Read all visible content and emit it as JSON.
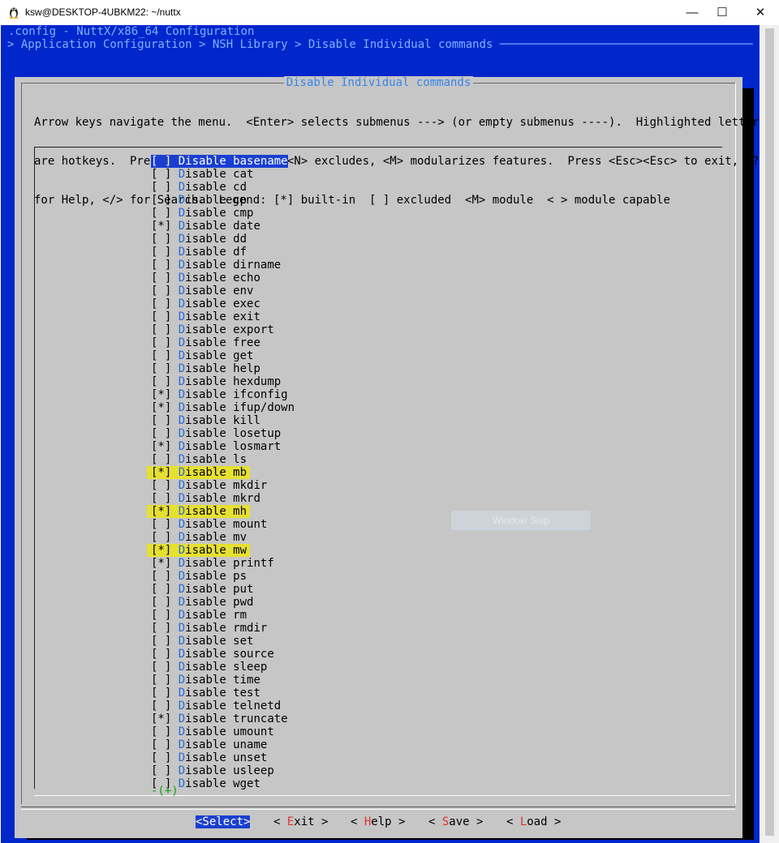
{
  "window": {
    "title": "ksw@DESKTOP-4UBKM22: ~/nuttx",
    "minimize": "—",
    "maximize": "☐",
    "close": "✕"
  },
  "header": {
    "line1": ".config - NuttX/x86_64 Configuration",
    "line2": "> Application Configuration > NSH Library > Disable Individual commands ─────────────────────────────────────"
  },
  "dialog": {
    "title": "Disable Individual commands",
    "help_lines": [
      "Arrow keys navigate the menu.  <Enter> selects submenus ---> (or empty submenus ----).  Highlighted letters",
      "are hotkeys.  Pressing <Y> includes, <N> excludes, <M> modularizes features.  Press <Esc><Esc> to exit, <?>",
      "for Help, </> for Search.  Legend: [*] built-in  [ ] excluded  <M> module  < > module capable"
    ]
  },
  "menu": {
    "items": [
      {
        "box": "[ ]",
        "hotkey": "D",
        "label": "isable basename",
        "selected": true
      },
      {
        "box": "[ ]",
        "hotkey": "D",
        "label": "isable cat"
      },
      {
        "box": "[ ]",
        "hotkey": "D",
        "label": "isable cd"
      },
      {
        "box": "[ ]",
        "hotkey": "D",
        "label": "isable cp"
      },
      {
        "box": "[ ]",
        "hotkey": "D",
        "label": "isable cmp"
      },
      {
        "box": "[*]",
        "hotkey": "D",
        "label": "isable date"
      },
      {
        "box": "[ ]",
        "hotkey": "D",
        "label": "isable dd"
      },
      {
        "box": "[ ]",
        "hotkey": "D",
        "label": "isable df"
      },
      {
        "box": "[ ]",
        "hotkey": "D",
        "label": "isable dirname"
      },
      {
        "box": "[ ]",
        "hotkey": "D",
        "label": "isable echo"
      },
      {
        "box": "[ ]",
        "hotkey": "D",
        "label": "isable env"
      },
      {
        "box": "[ ]",
        "hotkey": "D",
        "label": "isable exec"
      },
      {
        "box": "[ ]",
        "hotkey": "D",
        "label": "isable exit"
      },
      {
        "box": "[ ]",
        "hotkey": "D",
        "label": "isable export"
      },
      {
        "box": "[ ]",
        "hotkey": "D",
        "label": "isable free"
      },
      {
        "box": "[ ]",
        "hotkey": "D",
        "label": "isable get"
      },
      {
        "box": "[ ]",
        "hotkey": "D",
        "label": "isable help"
      },
      {
        "box": "[ ]",
        "hotkey": "D",
        "label": "isable hexdump"
      },
      {
        "box": "[*]",
        "hotkey": "D",
        "label": "isable ifconfig"
      },
      {
        "box": "[*]",
        "hotkey": "D",
        "label": "isable ifup/down"
      },
      {
        "box": "[ ]",
        "hotkey": "D",
        "label": "isable kill"
      },
      {
        "box": "[ ]",
        "hotkey": "D",
        "label": "isable losetup"
      },
      {
        "box": "[*]",
        "hotkey": "D",
        "label": "isable losmart"
      },
      {
        "box": "[ ]",
        "hotkey": "D",
        "label": "isable ls"
      },
      {
        "box": "[*]",
        "hotkey": "D",
        "label": "isable mb",
        "highlight": true
      },
      {
        "box": "[ ]",
        "hotkey": "D",
        "label": "isable mkdir"
      },
      {
        "box": "[ ]",
        "hotkey": "D",
        "label": "isable mkrd"
      },
      {
        "box": "[*]",
        "hotkey": "D",
        "label": "isable mh",
        "highlight": true
      },
      {
        "box": "[ ]",
        "hotkey": "D",
        "label": "isable mount"
      },
      {
        "box": "[ ]",
        "hotkey": "D",
        "label": "isable mv"
      },
      {
        "box": "[*]",
        "hotkey": "D",
        "label": "isable mw",
        "highlight": true
      },
      {
        "box": "[*]",
        "hotkey": "D",
        "label": "isable printf"
      },
      {
        "box": "[ ]",
        "hotkey": "D",
        "label": "isable ps"
      },
      {
        "box": "[ ]",
        "hotkey": "D",
        "label": "isable put"
      },
      {
        "box": "[ ]",
        "hotkey": "D",
        "label": "isable pwd"
      },
      {
        "box": "[ ]",
        "hotkey": "D",
        "label": "isable rm"
      },
      {
        "box": "[ ]",
        "hotkey": "D",
        "label": "isable rmdir"
      },
      {
        "box": "[ ]",
        "hotkey": "D",
        "label": "isable set"
      },
      {
        "box": "[ ]",
        "hotkey": "D",
        "label": "isable source"
      },
      {
        "box": "[ ]",
        "hotkey": "D",
        "label": "isable sleep"
      },
      {
        "box": "[ ]",
        "hotkey": "D",
        "label": "isable time"
      },
      {
        "box": "[ ]",
        "hotkey": "D",
        "label": "isable test"
      },
      {
        "box": "[ ]",
        "hotkey": "D",
        "label": "isable telnetd"
      },
      {
        "box": "[*]",
        "hotkey": "D",
        "label": "isable truncate"
      },
      {
        "box": "[ ]",
        "hotkey": "D",
        "label": "isable umount"
      },
      {
        "box": "[ ]",
        "hotkey": "D",
        "label": "isable uname"
      },
      {
        "box": "[ ]",
        "hotkey": "D",
        "label": "isable unset"
      },
      {
        "box": "[ ]",
        "hotkey": "D",
        "label": "isable usleep"
      },
      {
        "box": "[ ]",
        "hotkey": "D",
        "label": "isable wget"
      }
    ],
    "more_indicator": "-(+)",
    "highlight_color": "#e6e030"
  },
  "buttons": {
    "select": "<Select>",
    "exit": {
      "pre": "< ",
      "hotkey": "E",
      "rest": "xit >"
    },
    "help": {
      "pre": "< ",
      "hotkey": "H",
      "rest": "elp >"
    },
    "save": {
      "pre": "< ",
      "hotkey": "S",
      "rest": "ave >"
    },
    "load": {
      "pre": "< ",
      "hotkey": "L",
      "rest": "oad >"
    }
  },
  "overlay": {
    "snip_label": "Window Snip"
  },
  "colors": {
    "console_bg": "#0026cc",
    "dialog_bg": "#c6c6c6",
    "selection": "#1a3fd0",
    "hotkey": "#2a6bd6",
    "button_hotkey": "#e03030"
  }
}
